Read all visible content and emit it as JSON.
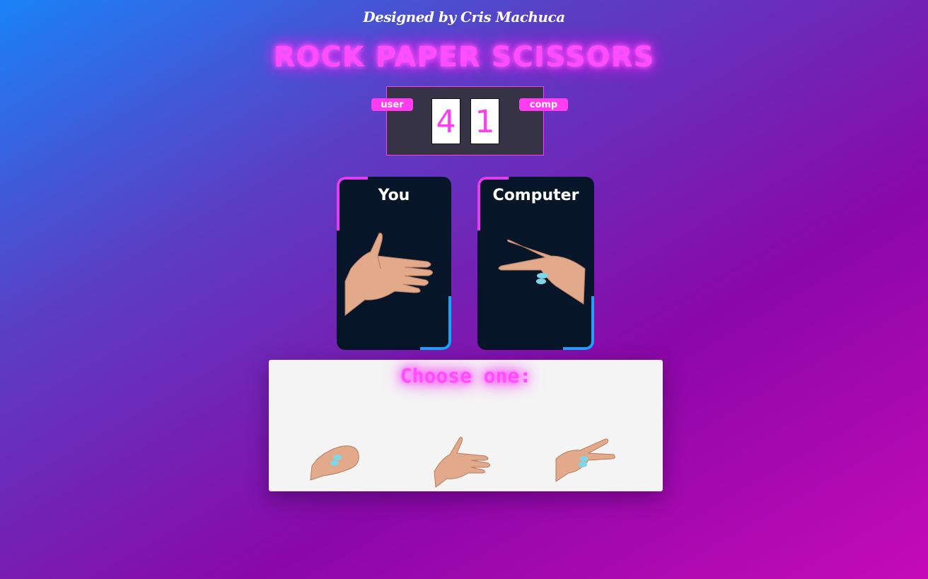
{
  "credit": "Designed by Cris Machuca",
  "title": "ROCK PAPER SCISSORS",
  "score": {
    "user_label": "user",
    "comp_label": "comp",
    "user_score": "4",
    "comp_score": "1"
  },
  "cards": {
    "you": {
      "title": "You",
      "hand": "paper-hand-icon"
    },
    "computer": {
      "title": "Computer",
      "hand": "scissors-hand-icon"
    }
  },
  "chooser": {
    "title": "Choose one:",
    "options": [
      {
        "name": "rock",
        "icon": "rock-hand-icon"
      },
      {
        "name": "paper",
        "icon": "paper-hand-icon"
      },
      {
        "name": "scissors",
        "icon": "scissors-hand-icon"
      }
    ]
  },
  "colors": {
    "accent_pink": "#ff3df0",
    "accent_blue": "#1aa3ff",
    "card_bg": "#061628",
    "scoreboard_bg": "#353345",
    "skin": "#e2a98a",
    "nail": "#7fd6e6"
  }
}
